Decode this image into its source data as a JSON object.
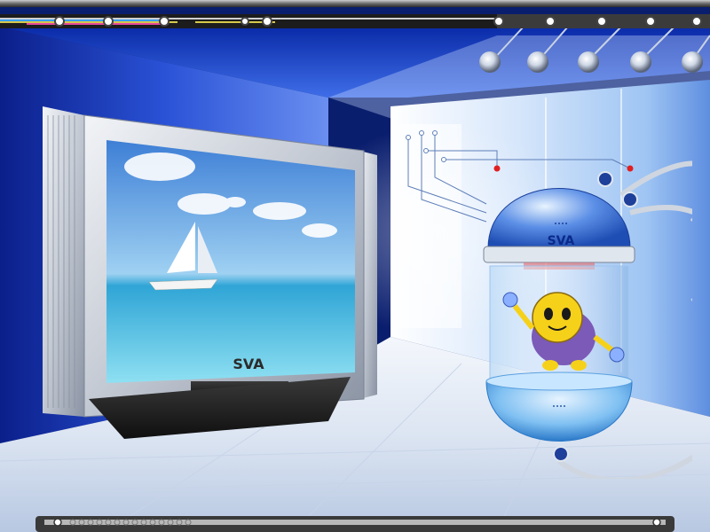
{
  "scene": {
    "tv_brand": "SVA",
    "pod_brand": "SVA"
  },
  "colors": {
    "room_blue": "#1b3fb8",
    "floor_white": "#e9eef7",
    "accent_cyan": "#8fd0ff",
    "mascot_yellow": "#f6d11a",
    "mascot_purple": "#7b5ab8"
  },
  "icons": {
    "spotlight": "spotlight-icon",
    "indicator": "indicator-dot-icon",
    "robot": "robot-mascot"
  }
}
